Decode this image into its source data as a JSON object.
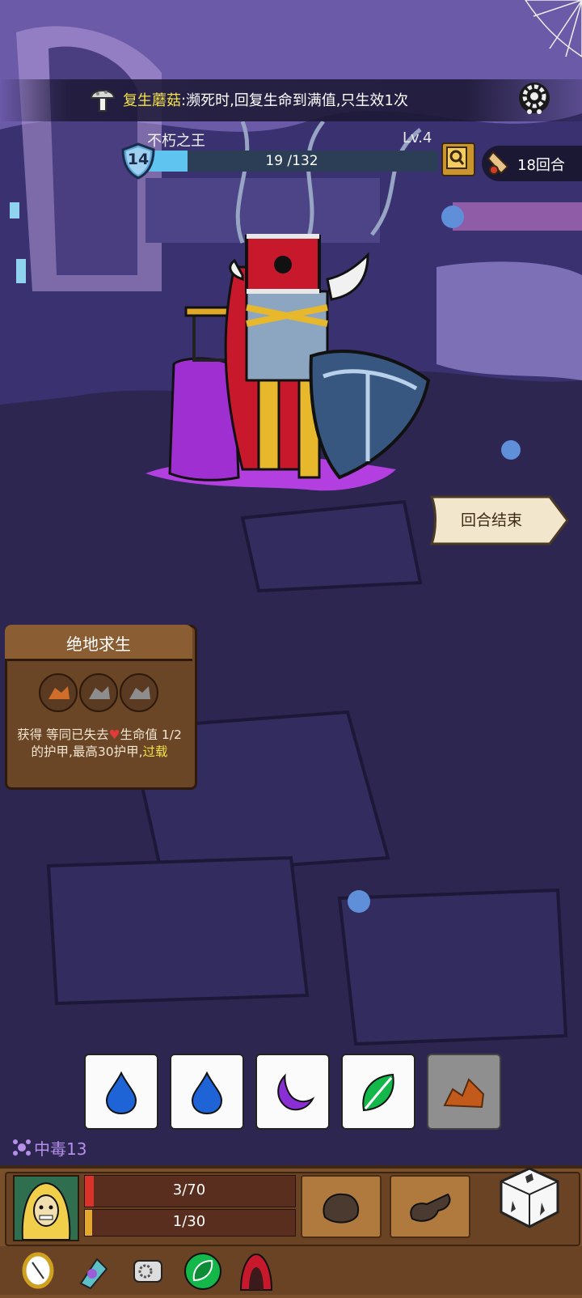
{
  "colors": {
    "background": "#2c2651",
    "highlight": "#f2e14a",
    "enemy_hp": "#5fc4f0",
    "player_hp": "#d9332b",
    "player_armor": "#e5a82e",
    "poison": "#b58fe8"
  },
  "top_banner": {
    "icon": "mushroom-icon",
    "item_name": "复生蘑菇",
    "separator": ":",
    "effect": "濒死时,回复生命到满值,只生效1次",
    "settings_icon": "gear-icon"
  },
  "enemy": {
    "name": "不朽之王",
    "level": "Lv.4",
    "armor": "14",
    "hp_text": "19 /132",
    "hp_current": 19,
    "hp_max": 132
  },
  "turn_counter": {
    "icon": "scroll-icon",
    "text": "18回合"
  },
  "end_turn_button": {
    "label": "回合结束"
  },
  "skill_card": {
    "title": "绝地求生",
    "slots": [
      "rock-slot-icon",
      "rock-slot-icon",
      "rock-slot-icon"
    ],
    "desc_part1": "获得 等同已失去",
    "desc_part2": "生命值 1/2 的护甲,最高30护甲,",
    "desc_overload": "过载"
  },
  "dice": [
    {
      "face": "water-drop-icon",
      "used": false
    },
    {
      "face": "water-drop-icon",
      "used": false
    },
    {
      "face": "moon-icon",
      "used": false
    },
    {
      "face": "leaf-icon",
      "used": false
    },
    {
      "face": "rock-icon",
      "used": true
    }
  ],
  "status": {
    "label": "中毒",
    "value": "13"
  },
  "player": {
    "hp_text": "3/70",
    "hp_current": 3,
    "hp_max": 70,
    "armor_text": "1/30",
    "armor_current": 1,
    "armor_max": 30
  },
  "action_slots": [
    "fist-icon",
    "smash-icon"
  ],
  "items": [
    "mirror-icon",
    "potion-icon",
    "scroll-gear-icon",
    "leaf-orb-icon",
    "hood-icon"
  ]
}
